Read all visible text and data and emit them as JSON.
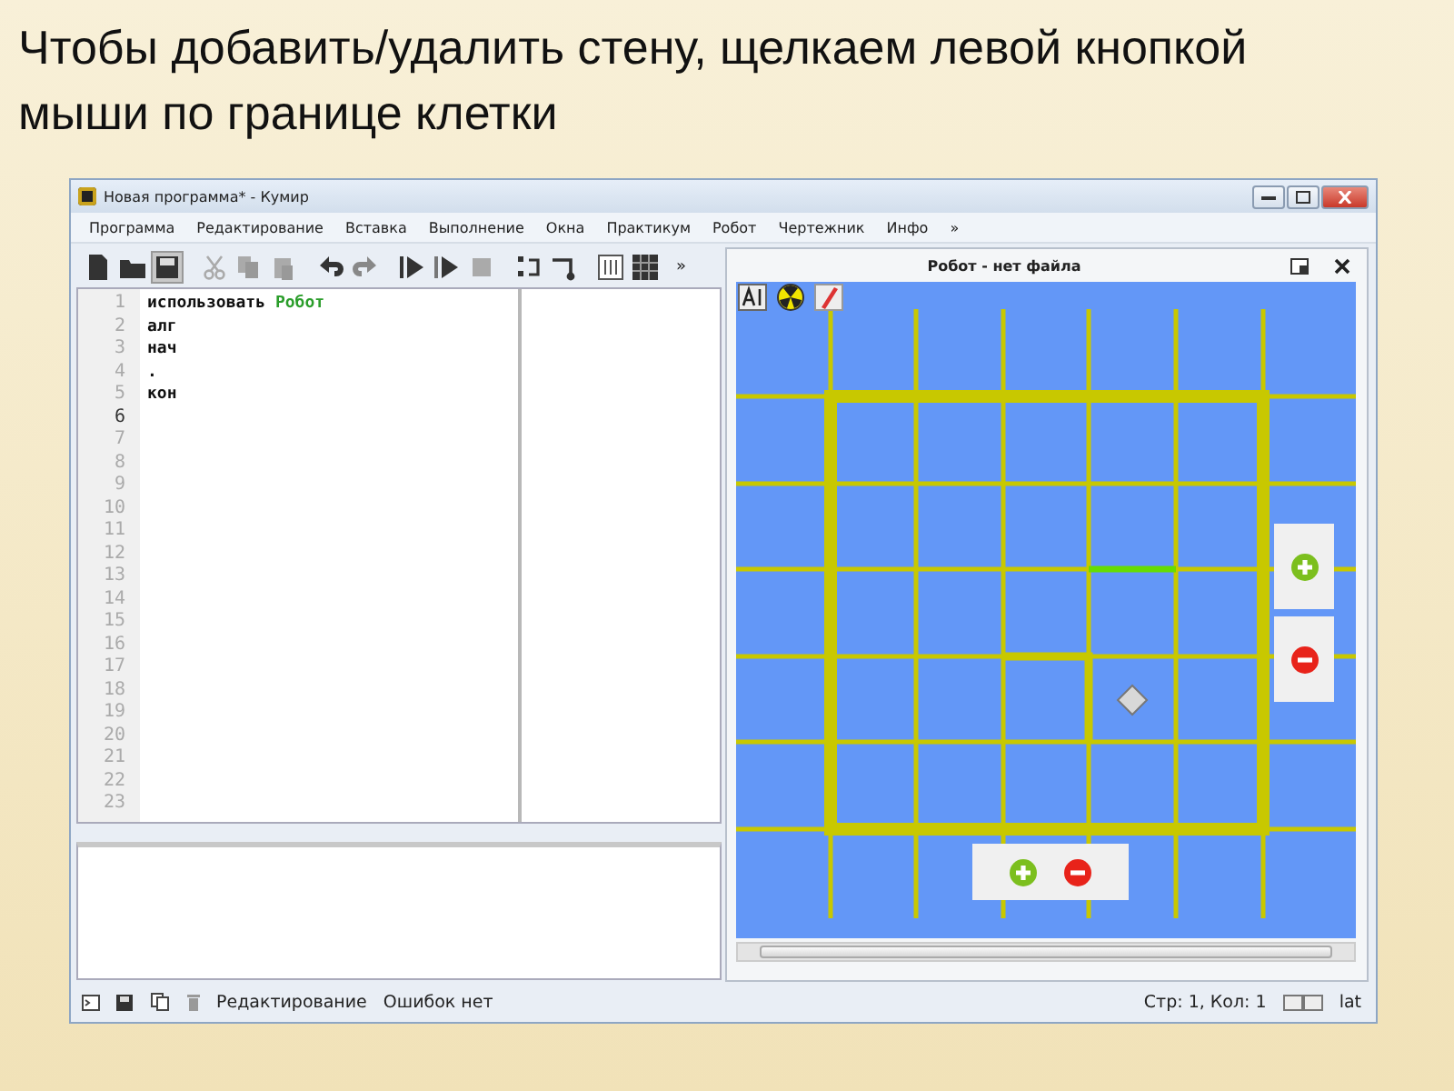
{
  "slide": {
    "heading": "Чтобы добавить/удалить стену, щелкаем левой кнопкой мыши по границе клетки"
  },
  "window": {
    "title": "Новая программа* - Кумир"
  },
  "menu": [
    {
      "label": "Программа"
    },
    {
      "label": "Редактирование"
    },
    {
      "label": "Вставка"
    },
    {
      "label": "Выполнение"
    },
    {
      "label": "Окна"
    },
    {
      "label": "Практикум"
    },
    {
      "label": "Робот"
    },
    {
      "label": "Чертежник"
    },
    {
      "label": "Инфо"
    },
    {
      "label": "»"
    }
  ],
  "toolbar": {
    "overflow": "»"
  },
  "editor": {
    "lines": [
      {
        "number": "1",
        "current": false,
        "tokens": [
          {
            "text": "использовать",
            "kind": "keyword"
          },
          {
            "text": "Робот",
            "kind": "module"
          }
        ]
      },
      {
        "number": "2",
        "current": false,
        "tokens": [
          {
            "text": "алг",
            "kind": "keyword"
          }
        ]
      },
      {
        "number": "3",
        "current": false,
        "tokens": [
          {
            "text": "нач",
            "kind": "keyword"
          }
        ]
      },
      {
        "number": "4",
        "current": false,
        "tokens": [
          {
            "text": ".",
            "kind": "keyword"
          }
        ]
      },
      {
        "number": "5",
        "current": false,
        "tokens": [
          {
            "text": "кон",
            "kind": "keyword"
          }
        ]
      },
      {
        "number": "6",
        "current": true
      },
      {
        "number": "7",
        "current": false
      },
      {
        "number": "8",
        "current": false
      },
      {
        "number": "9",
        "current": false
      },
      {
        "number": "10",
        "current": false
      },
      {
        "number": "11",
        "current": false
      },
      {
        "number": "12",
        "current": false
      },
      {
        "number": "13",
        "current": false
      },
      {
        "number": "14",
        "current": false
      },
      {
        "number": "15",
        "current": false
      },
      {
        "number": "16",
        "current": false
      },
      {
        "number": "17",
        "current": false
      },
      {
        "number": "18",
        "current": false
      },
      {
        "number": "19",
        "current": false
      },
      {
        "number": "20",
        "current": false
      },
      {
        "number": "21",
        "current": false
      },
      {
        "number": "22",
        "current": false
      },
      {
        "number": "23",
        "current": false
      }
    ]
  },
  "robot_panel": {
    "title": "Робот - нет файла"
  },
  "status_bar": {
    "mode": "Редактирование",
    "errors": "Ошибок нет",
    "position": "Стр: 1, Кол: 1",
    "layout": "lat"
  }
}
